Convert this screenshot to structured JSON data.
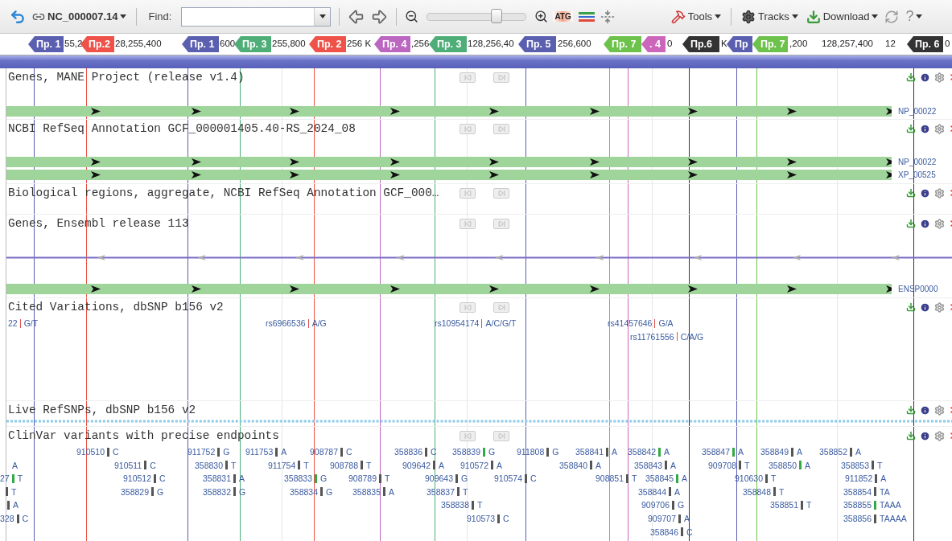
{
  "toolbar": {
    "sequence": "NC_000007.14",
    "find_label": "Find:",
    "atg": "ATG",
    "zoom_slider": {
      "level": 0.7
    },
    "menus": [
      "Tools",
      "Tracks",
      "Download"
    ],
    "help": "?"
  },
  "ruler_ticks": [
    "55,2",
    "28,255,400",
    "600",
    "255,800",
    "256 K",
    ",256",
    "128,256,40",
    "256,600",
    "0",
    "K",
    ",200",
    "128,257,400",
    "12",
    "0"
  ],
  "markers": [
    {
      "label": "Пр. 1",
      "color": "#5a5fb0"
    },
    {
      "label": "Пр.2",
      "color": "#ee5248"
    },
    {
      "label": "Пр. 1",
      "color": "#5a5fb0"
    },
    {
      "label": "Пр. 3",
      "color": "#4fae78"
    },
    {
      "label": "Пр. 2",
      "color": "#ee5248"
    },
    {
      "label": "Пр. 4",
      "color": "#bb66c0"
    },
    {
      "label": "Пр. 3",
      "color": "#4fae78"
    },
    {
      "label": "Пр. 5",
      "color": "#5a5fb0"
    },
    {
      "label": "Пр. 7",
      "color": "#6cc24a"
    },
    {
      "label": ". 4",
      "color": "#cc66bb"
    },
    {
      "label": "Пр.6",
      "color": "#333333"
    },
    {
      "label": "Пр",
      "color": "#5a5fb0"
    },
    {
      "label": "Пр. 7",
      "color": "#6cc24a"
    },
    {
      "label": "Пр. 6",
      "color": "#333333"
    }
  ],
  "tracks": [
    {
      "title": "Genes, MANE Project (release v1.4)",
      "nav": true,
      "features": [
        {
          "kind": "protein",
          "label": "NP_00022"
        }
      ]
    },
    {
      "title": "NCBI RefSeq Annotation GCF_000001405.40-RS_2024_08",
      "nav": true,
      "features": [
        {
          "kind": "protein",
          "label": "NP_00022"
        },
        {
          "kind": "protein",
          "label": "XP_00525"
        }
      ]
    },
    {
      "title": "Biological regions, aggregate, NCBI RefSeq Annotation GCF_000…",
      "nav": true
    },
    {
      "title": "Genes, Ensembl release 113",
      "nav": true,
      "features": [
        {
          "kind": "transcript"
        },
        {
          "kind": "protein",
          "label": "ENSP0000"
        }
      ]
    },
    {
      "title": "Cited Variations, dbSNP b156 v2",
      "nav": true,
      "variants": [
        {
          "id": "22",
          "allele": "G/T",
          "color": "#e05050"
        },
        {
          "id": "rs6966536",
          "allele": "A/G",
          "color": "#e05050"
        },
        {
          "id": "rs10954174",
          "allele": "A/C/G/T",
          "color": "#e05050"
        },
        {
          "id": "rs41457646",
          "allele": "G/A",
          "color": "#e05050"
        },
        {
          "id": "rs11761556",
          "allele": "C/A/G",
          "color": "#e05050"
        }
      ]
    },
    {
      "title": "Live RefSNPs, dbSNP b156 v2",
      "nav": false,
      "features": [
        {
          "kind": "density"
        }
      ]
    },
    {
      "title": "ClinVar variants with precise endpoints",
      "nav": true,
      "variants": [
        {
          "id": "910510",
          "allele": "C",
          "color": "#555555"
        },
        {
          "id": "911752",
          "allele": "G",
          "color": "#555555"
        },
        {
          "id": "911753",
          "allele": "A",
          "color": "#555555"
        },
        {
          "id": "908787",
          "allele": "C",
          "color": "#555555"
        },
        {
          "id": "358836",
          "allele": "C",
          "color": "#555555"
        },
        {
          "id": "358839",
          "allele": "G",
          "color": "#33aa44"
        },
        {
          "id": "911808",
          "allele": "G",
          "color": "#555555"
        },
        {
          "id": "358841",
          "allele": "A",
          "color": "#555555"
        },
        {
          "id": "358842",
          "allele": "A",
          "color": "#33aa44"
        },
        {
          "id": "358847",
          "allele": "A",
          "color": "#33aa44"
        },
        {
          "id": "358849",
          "allele": "A",
          "color": "#555555"
        },
        {
          "id": "358852",
          "allele": "A",
          "color": "#555555"
        },
        {
          "allele": "A"
        },
        {
          "id": "910511",
          "allele": "C",
          "color": "#555555"
        },
        {
          "id": "358830",
          "allele": "T",
          "color": "#555555"
        },
        {
          "id": "911754",
          "allele": "T",
          "color": "#555555"
        },
        {
          "id": "908788",
          "allele": "T",
          "color": "#555555"
        },
        {
          "id": "909642",
          "allele": "A",
          "color": "#555555"
        },
        {
          "id": "910572",
          "allele": "A",
          "color": "#555555"
        },
        {
          "id": "358840",
          "allele": "A",
          "color": "#555555"
        },
        {
          "id": "358843",
          "allele": "A",
          "color": "#555555"
        },
        {
          "id": "909708",
          "allele": "T",
          "color": "#555555"
        },
        {
          "id": "358850",
          "allele": "A",
          "color": "#33aa44"
        },
        {
          "id": "358853",
          "allele": "T",
          "color": "#555555"
        },
        {
          "id": "27",
          "allele": "T",
          "color": "#33aa44"
        },
        {
          "id": "910512",
          "allele": "C",
          "color": "#555555"
        },
        {
          "id": "358831",
          "allele": "A",
          "color": "#555555"
        },
        {
          "id": "358833",
          "allele": "G",
          "color": "#33aa44"
        },
        {
          "id": "908789",
          "allele": "T",
          "color": "#555555"
        },
        {
          "id": "909643",
          "allele": "G",
          "color": "#555555"
        },
        {
          "id": "910574",
          "allele": "C",
          "color": "#555555"
        },
        {
          "id": "908851",
          "allele": "T",
          "color": "#555555"
        },
        {
          "id": "358845",
          "allele": "A",
          "color": "#33aa44"
        },
        {
          "id": "910630",
          "allele": "T",
          "color": "#555555"
        },
        {
          "id": "911852",
          "allele": "A",
          "color": "#555555"
        },
        {
          "allele": "T",
          "color": "#555555"
        },
        {
          "id": "358829",
          "allele": "G",
          "color": "#555555"
        },
        {
          "id": "358832",
          "allele": "G",
          "color": "#555555"
        },
        {
          "id": "358834",
          "allele": "G",
          "color": "#555555"
        },
        {
          "id": "358835",
          "allele": "A",
          "color": "#555555"
        },
        {
          "id": "358837",
          "allele": "T",
          "color": "#555555"
        },
        {
          "id": "358844",
          "allele": "A",
          "color": "#555555"
        },
        {
          "id": "358848",
          "allele": "T",
          "color": "#555555"
        },
        {
          "id": "358854",
          "allele": "TA",
          "color": "#555555"
        },
        {
          "allele": "A",
          "color": "#555555"
        },
        {
          "id": "358838",
          "allele": "T",
          "color": "#555555"
        },
        {
          "id": "909706",
          "allele": "G",
          "color": "#555555"
        },
        {
          "id": "358851",
          "allele": "T",
          "color": "#555555"
        },
        {
          "id": "358855",
          "allele": "TAAA",
          "color": "#33aa44"
        },
        {
          "id": "328",
          "allele": "C",
          "color": "#555555"
        },
        {
          "id": "910573",
          "allele": "C",
          "color": "#555555"
        },
        {
          "id": "909707",
          "allele": "A",
          "color": "#555555"
        },
        {
          "id": "358856",
          "allele": "TAAAA",
          "color": "#555555"
        },
        {
          "id": "358846",
          "allele": "C",
          "color": "#555555"
        }
      ]
    }
  ]
}
